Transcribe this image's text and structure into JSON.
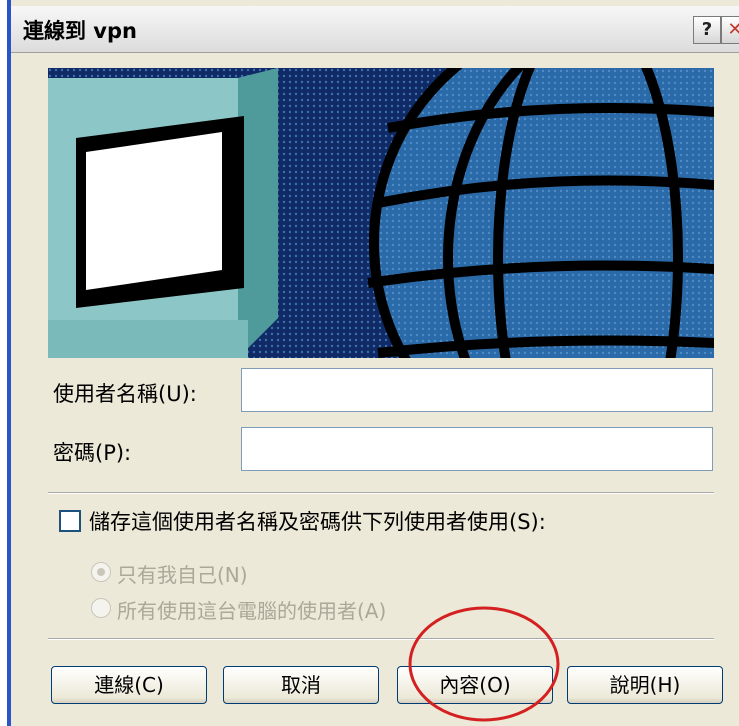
{
  "window": {
    "title": "連線到 vpn",
    "help_glyph": "?",
    "close_glyph": "✕"
  },
  "banner": {
    "illustration": "computer-monitor-and-globe"
  },
  "form": {
    "username_label": "使用者名稱(U):",
    "username_value": "",
    "password_label": "密碼(P):",
    "password_value": "",
    "save_checkbox_label": "儲存這個使用者名稱及密碼供下列使用者使用(S):",
    "save_checked": false,
    "radio_options": [
      {
        "label": "只有我自己(N)",
        "selected": true,
        "enabled": false
      },
      {
        "label": "所有使用這台電腦的使用者(A)",
        "selected": false,
        "enabled": false
      }
    ]
  },
  "buttons": {
    "connect": "連線(C)",
    "cancel": "取消",
    "properties": "內容(O)",
    "help": "說明(H)"
  },
  "colors": {
    "window_bg": "#ece9d8",
    "banner_bg": "#0f2a64",
    "globe": "#1f5fa8",
    "monitor": "#87c0c0",
    "annotation_circle": "#d42020"
  }
}
